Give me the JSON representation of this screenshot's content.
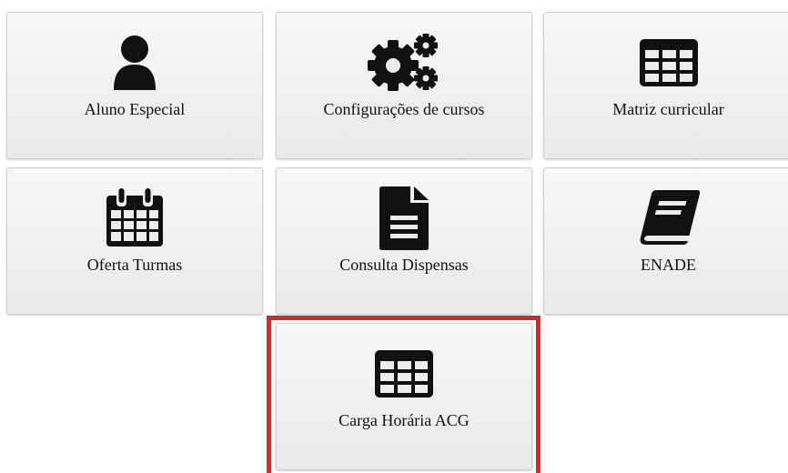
{
  "tiles": [
    {
      "label": "Aluno Especial",
      "icon": "user-icon"
    },
    {
      "label": "Configurações de cursos",
      "icon": "gears-icon"
    },
    {
      "label": "Matriz curricular",
      "icon": "table-icon"
    },
    {
      "label": "Oferta Turmas",
      "icon": "calendar-icon"
    },
    {
      "label": "Consulta Dispensas",
      "icon": "document-icon"
    },
    {
      "label": "ENADE",
      "icon": "book-icon"
    },
    {
      "label": "Carga Horária ACG",
      "icon": "table-icon"
    }
  ],
  "colors": {
    "highlight": "#d8282f",
    "icon": "#111111",
    "tile_bg": "#efefef"
  }
}
